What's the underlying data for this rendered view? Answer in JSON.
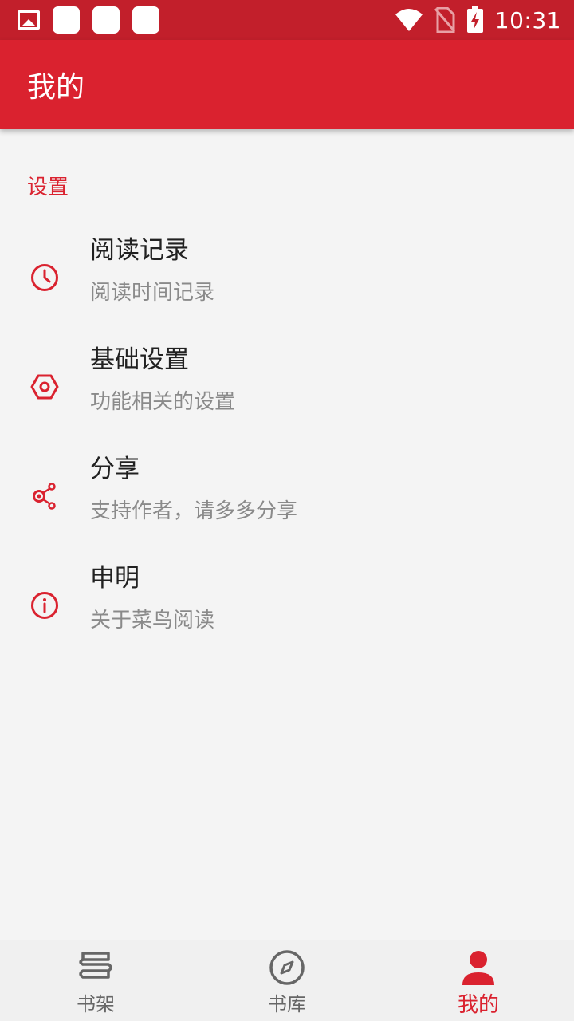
{
  "status_bar": {
    "time": "10:31",
    "icons": [
      "image-icon",
      "notification-icon",
      "notification-icon",
      "notification-icon",
      "wifi-icon",
      "no-sim-icon",
      "battery-charging-icon"
    ]
  },
  "app_bar": {
    "title": "我的"
  },
  "settings": {
    "header": "设置",
    "items": [
      {
        "icon": "clock-icon",
        "title": "阅读记录",
        "subtitle": "阅读时间记录"
      },
      {
        "icon": "settings-hex-icon",
        "title": "基础设置",
        "subtitle": "功能相关的设置"
      },
      {
        "icon": "share-icon",
        "title": "分享",
        "subtitle": "支持作者，请多多分享"
      },
      {
        "icon": "info-icon",
        "title": "申明",
        "subtitle": "关于菜鸟阅读"
      }
    ]
  },
  "bottom_nav": {
    "tabs": [
      {
        "label": "书架",
        "icon": "bookshelf-icon",
        "active": false
      },
      {
        "label": "书库",
        "icon": "compass-icon",
        "active": false
      },
      {
        "label": "我的",
        "icon": "person-icon",
        "active": true
      }
    ]
  },
  "colors": {
    "status_bar": "#c21f2b",
    "primary": "#da222f",
    "background": "#f4f4f4",
    "title_text": "#212121",
    "subtitle_text": "#8a8a8a"
  }
}
